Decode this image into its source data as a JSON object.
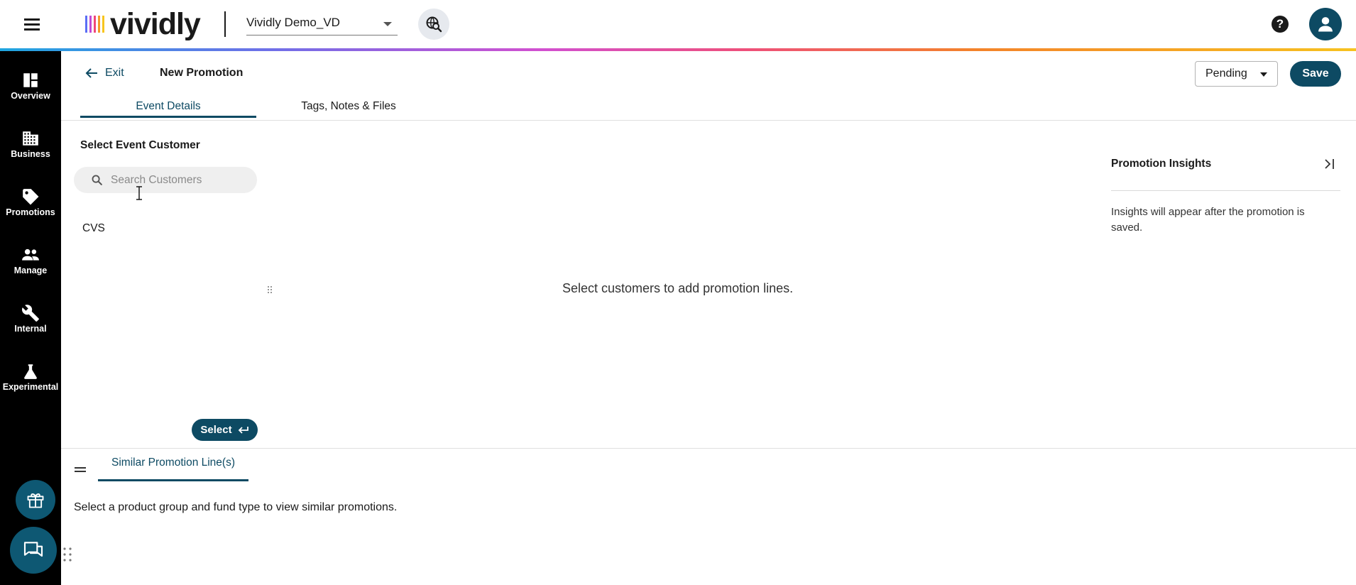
{
  "header": {
    "logo_text": "vividly",
    "logo_bar_colors": [
      "#5b6ef5",
      "#c04bd6",
      "#f0477a",
      "#f39a2b",
      "#f7c51e"
    ],
    "org_selected": "Vividly Demo_VD",
    "icons": [
      "menu-icon",
      "globe-search-icon",
      "help-icon",
      "user-icon"
    ]
  },
  "nav": {
    "items": [
      {
        "label": "Overview",
        "icon": "dashboard-icon"
      },
      {
        "label": "Business",
        "icon": "building-icon"
      },
      {
        "label": "Promotions",
        "icon": "tag-icon"
      },
      {
        "label": "Manage",
        "icon": "people-icon"
      },
      {
        "label": "Internal",
        "icon": "wrench-icon"
      },
      {
        "label": "Experimental",
        "icon": "flask-icon"
      }
    ],
    "fab_icons": [
      "gift-icon",
      "chat-icon"
    ]
  },
  "toolbar": {
    "exit_label": "Exit",
    "title": "New Promotion",
    "status_value": "Pending",
    "save_label": "Save"
  },
  "tabs": [
    {
      "label": "Event Details",
      "active": true
    },
    {
      "label": "Tags, Notes & Files",
      "active": false
    }
  ],
  "customer_panel": {
    "section_label": "Select Event Customer",
    "search_placeholder": "Search Customers",
    "search_value": "",
    "customers": [
      "CVS"
    ],
    "select_label": "Select"
  },
  "main_panel": {
    "empty_message": "Select customers to add promotion lines."
  },
  "insights": {
    "title": "Promotion Insights",
    "message": "Insights will appear after the promotion is saved."
  },
  "similar": {
    "tab_label": "Similar Promotion Line(s)",
    "message": "Select a product group and fund type to view similar promotions."
  },
  "colors": {
    "primary": "#0d4a63",
    "nav_bg": "#000000",
    "fab": "#0e5873"
  }
}
